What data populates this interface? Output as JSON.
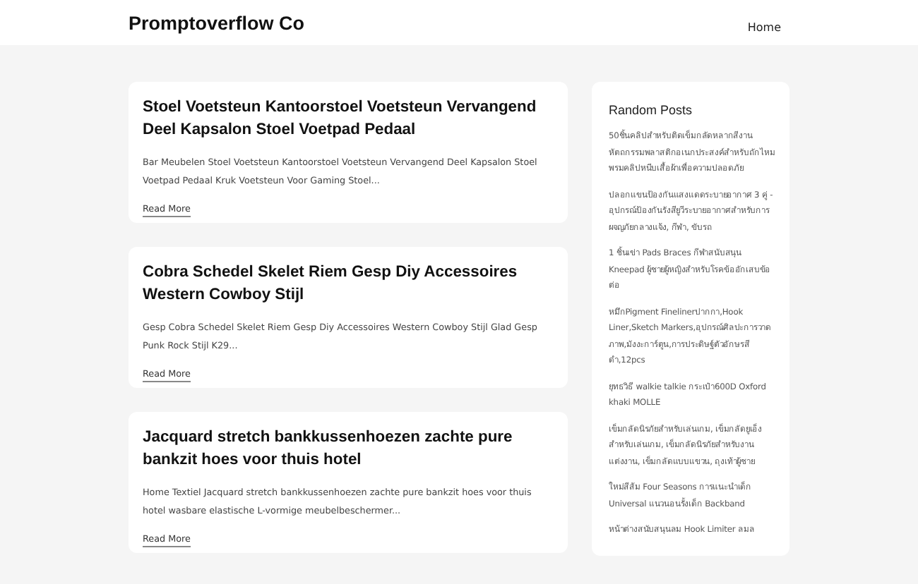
{
  "site": {
    "brand": "Promptoverflow Co",
    "nav": [
      {
        "label": "Home"
      }
    ]
  },
  "posts": [
    {
      "title": "Stoel Voetsteun Kantoorstoel Voetsteun Vervangend Deel Kapsalon Stoel Voetpad Pedaal",
      "excerpt": "Bar Meubelen Stoel Voetsteun Kantoorstoel Voetsteun Vervangend Deel Kapsalon Stoel Voetpad Pedaal Kruk Voetsteun Voor Gaming Stoel...",
      "link": "Read More"
    },
    {
      "title": "Cobra Schedel Skelet Riem Gesp Diy Accessoires Western Cowboy Stijl",
      "excerpt": "Gesp Cobra Schedel Skelet Riem Gesp Diy Accessoires Western Cowboy Stijl Glad Gesp Punk Rock Stijl K29...",
      "link": "Read More"
    },
    {
      "title": "Jacquard stretch bankkussenhoezen zachte pure bankzit hoes voor thuis hotel",
      "excerpt": "Home Textiel Jacquard stretch bankkussenhoezen zachte pure bankzit hoes voor thuis hotel wasbare elastische L-vormige meubelbeschermer...",
      "link": "Read More"
    }
  ],
  "sidebar": {
    "title": "Random Posts",
    "items": [
      "50ชิ้นคลิปสำหรับติดเข็มกลัดหลากสีงานหัตถกรรมพลาสติกอเนกประสงค์สำหรับถักไหมพรมคลิปหนีบเสื้อผ้าเพื่อความปลอดภัย",
      "ปลอกแขนป้องกันแสงแดดระบายอากาศ 3 คู่ - อุปกรณ์ป้องกันรังสียูวีระบายอากาศสำหรับการผจญภัยกลางแจ้ง, กีฬา, ขับรถ",
      "1 ชิ้นเข่า Pads Braces กีฬาสนับสนุน Kneepad ผู้ชายผู้หญิงสำหรับโรคข้ออักเสบข้อต่อ",
      "หมึกPigment Finelinerปากกา,Hook Liner,Sketch Markers,อุปกรณ์ศิลปะการวาดภาพ,มังงะการ์ตูน,การประดิษฐ์ตัวอักษรสีดำ,12pcs",
      "ยุทธวิธี walkie talkie กระเป๋า600D Oxford khaki MOLLE",
      "เข็มกลัดนิรภัยสำหรับเล่นเกม, เข็มกลัดยูเอ็งสำหรับเล่นเกม, เข็มกลัดนิรภัยสำหรับงานแต่งงาน, เข็มกลัดแบบแขวน, ถุงเท้าผู้ชาย",
      "ใหม่สีส้ม Four Seasons การแนะนำเด็ก Universal แนวนอนรั้งเด็ก Backband",
      "หน้าต่างสนับสนุนลม Hook Limiter ลมล"
    ]
  }
}
